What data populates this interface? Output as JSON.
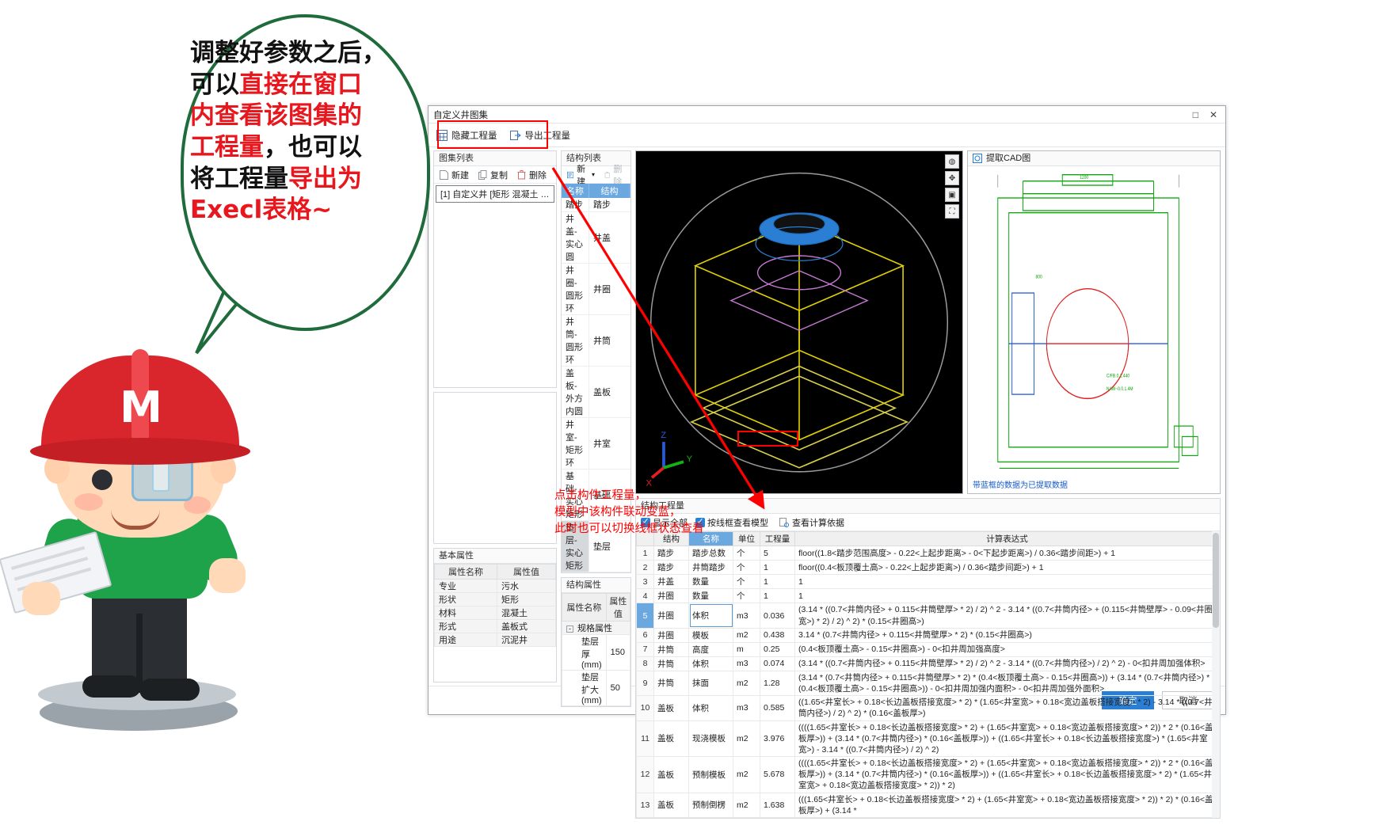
{
  "bubble": {
    "lines": [
      [
        {
          "t": "调整好参数之后，",
          "hl": false
        }
      ],
      [
        {
          "t": "可以",
          "hl": false
        },
        {
          "t": "直接在窗口",
          "hl": true
        }
      ],
      [
        {
          "t": "内查看该图集的",
          "hl": true
        }
      ],
      [
        {
          "t": "工程量",
          "hl": true
        },
        {
          "t": "，也可以",
          "hl": false
        }
      ],
      [
        {
          "t": "将工程量",
          "hl": false
        },
        {
          "t": "导出为",
          "hl": true
        }
      ],
      [
        {
          "t": "Execl表格~",
          "hl": true
        }
      ]
    ]
  },
  "annotation": {
    "note_lines": [
      "点击构件工程量，",
      "模型中该构件联动变蓝，",
      "此时也可以切换线框状态查看"
    ],
    "color": "#ff0000"
  },
  "window": {
    "title": "自定义井图集",
    "maximize_label": "□",
    "close_label": "✕"
  },
  "toolbar": {
    "items": [
      {
        "icon": "grid-hide-icon",
        "label": "隐藏工程量"
      },
      {
        "icon": "export-icon",
        "label": "导出工程量"
      }
    ]
  },
  "atlas_panel": {
    "header": "图集列表",
    "tools": [
      {
        "icon": "new-file-icon",
        "label": "新建"
      },
      {
        "icon": "copy-icon",
        "label": "复制"
      },
      {
        "icon": "trash-icon",
        "label": "删除"
      }
    ],
    "items": [
      "[1] 自定义井 [矩形 混凝土 污水 盖板..."
    ]
  },
  "basic_props": {
    "header": "基本属性",
    "columns": [
      "属性名称",
      "属性值"
    ],
    "rows": [
      [
        "专业",
        "污水"
      ],
      [
        "形状",
        "矩形"
      ],
      [
        "材料",
        "混凝土"
      ],
      [
        "形式",
        "盖板式"
      ],
      [
        "用途",
        "沉泥井"
      ]
    ]
  },
  "struct_list": {
    "header": "结构列表",
    "tools": [
      {
        "icon": "new-struct-icon",
        "label": "新建",
        "dim": false,
        "caret": "▾"
      },
      {
        "icon": "trash-icon",
        "label": "删除",
        "dim": true
      }
    ],
    "columns": [
      "名称",
      "结构"
    ],
    "rows": [
      {
        "name": "踏步",
        "struct": "踏步",
        "selected": false
      },
      {
        "name": "井盖-实心圆",
        "struct": "井盖",
        "selected": false
      },
      {
        "name": "井圈-圆形环",
        "struct": "井圈",
        "selected": false
      },
      {
        "name": "井筒-圆形环",
        "struct": "井筒",
        "selected": false
      },
      {
        "name": "盖板-外方内圆",
        "struct": "盖板",
        "selected": false
      },
      {
        "name": "井室-矩形环",
        "struct": "井室",
        "selected": false
      },
      {
        "name": "基础-实心矩形",
        "struct": "基础",
        "selected": false
      },
      {
        "name": "垫层-实心矩形",
        "struct": "垫层",
        "selected": true
      }
    ]
  },
  "struct_props": {
    "header": "结构属性",
    "columns": [
      "属性名称",
      "属性值"
    ],
    "group": "规格属性",
    "rows": [
      [
        "垫层厚(mm)",
        "150"
      ],
      [
        "垫层扩大(mm)",
        "50"
      ]
    ]
  },
  "model_view": {
    "axis_labels": [
      "X",
      "Y",
      "Z"
    ],
    "tools": [
      "orbit-icon",
      "pan-icon",
      "box-icon",
      "fit-icon"
    ]
  },
  "cad_panel": {
    "header": "提取CAD图",
    "icon": "cad-icon",
    "footer_note": "带蓝框的数据为已提取数据"
  },
  "quantity": {
    "header": "结构工程量",
    "options": [
      {
        "label": "显示全部",
        "checked": true
      },
      {
        "label": "按线框查看模型",
        "checked": true
      }
    ],
    "link": {
      "icon": "calc-basis-icon",
      "label": "查看计算依据"
    },
    "columns": [
      "",
      "结构",
      "名称",
      "单位",
      "工程量",
      "计算表达式"
    ],
    "selected_column": "名称",
    "rows": [
      {
        "idx": "1",
        "struct": "踏步",
        "name": "踏步总数",
        "unit": "个",
        "qty": "5",
        "expr": "floor((1.8<踏步范围高度> - 0.22<上起步距离> - 0<下起步距离>) / 0.36<踏步间距>) + 1",
        "selected": false,
        "boxed": false
      },
      {
        "idx": "2",
        "struct": "踏步",
        "name": "井筒踏步",
        "unit": "个",
        "qty": "1",
        "expr": "floor((0.4<板顶覆土高> - 0.22<上起步距离>) / 0.36<踏步间距>) + 1",
        "selected": false,
        "boxed": false
      },
      {
        "idx": "3",
        "struct": "井盖",
        "name": "数量",
        "unit": "个",
        "qty": "1",
        "expr": "1",
        "selected": false,
        "boxed": false
      },
      {
        "idx": "4",
        "struct": "井圈",
        "name": "数量",
        "unit": "个",
        "qty": "1",
        "expr": "1",
        "selected": false,
        "boxed": false
      },
      {
        "idx": "5",
        "struct": "井圈",
        "name": "体积",
        "unit": "m3",
        "qty": "0.036",
        "expr": "(3.14 * ((0.7<井筒内径> + 0.115<井筒壁厚> * 2) / 2) ^ 2 - 3.14 * ((0.7<井筒内径> + (0.115<井筒壁厚> - 0.09<井圈宽>) * 2) / 2) ^ 2) * (0.15<井圈高>)",
        "selected": true,
        "boxed": true
      },
      {
        "idx": "6",
        "struct": "井圈",
        "name": "模板",
        "unit": "m2",
        "qty": "0.438",
        "expr": "3.14 * (0.7<井筒内径> + 0.115<井筒壁厚> * 2) * (0.15<井圈高>)",
        "selected": false,
        "boxed": false
      },
      {
        "idx": "7",
        "struct": "井筒",
        "name": "高度",
        "unit": "m",
        "qty": "0.25",
        "expr": "(0.4<板顶覆土高> - 0.15<井圈高>) - 0<扣井周加强高度>",
        "selected": false,
        "boxed": false
      },
      {
        "idx": "8",
        "struct": "井筒",
        "name": "体积",
        "unit": "m3",
        "qty": "0.074",
        "expr": "(3.14 * ((0.7<井筒内径> + 0.115<井筒壁厚> * 2) / 2) ^ 2 - 3.14 * ((0.7<井筒内径>) / 2) ^ 2) - 0<扣井周加强体积>",
        "selected": false,
        "boxed": false
      },
      {
        "idx": "9",
        "struct": "井筒",
        "name": "抹面",
        "unit": "m2",
        "qty": "1.28",
        "expr": "(3.14 * (0.7<井筒内径> + 0.115<井筒壁厚> * 2) * (0.4<板顶覆土高> - 0.15<井圈高>)) + (3.14 * (0.7<井筒内径>) * (0.4<板顶覆土高> - 0.15<井圈高>)) - 0<扣井周加强内面积> - 0<扣井周加强外面积>",
        "selected": false,
        "boxed": false
      },
      {
        "idx": "10",
        "struct": "盖板",
        "name": "体积",
        "unit": "m3",
        "qty": "0.585",
        "expr": "((1.65<井室长> + 0.18<长边盖板搭接宽度> * 2) * (1.65<井室宽> + 0.18<宽边盖板搭接宽度> * 2) - 3.14 * ((0.7<井筒内径>) / 2) ^ 2) * (0.16<盖板厚>)",
        "selected": false,
        "boxed": false
      },
      {
        "idx": "11",
        "struct": "盖板",
        "name": "现浇模板",
        "unit": "m2",
        "qty": "3.976",
        "expr": "((((1.65<井室长> + 0.18<长边盖板搭接宽度> * 2) + (1.65<井室宽> + 0.18<宽边盖板搭接宽度> * 2)) * 2 * (0.16<盖板厚>)) + (3.14 * (0.7<井筒内径>) * (0.16<盖板厚>)) + ((1.65<井室长> + 0.18<长边盖板搭接宽度>) * (1.65<井室宽>) - 3.14 * ((0.7<井筒内径>) / 2) ^ 2)",
        "selected": false,
        "boxed": false
      },
      {
        "idx": "12",
        "struct": "盖板",
        "name": "预制模板",
        "unit": "m2",
        "qty": "5.678",
        "expr": "((((1.65<井室长> + 0.18<长边盖板搭接宽度> * 2) + (1.65<井室宽> + 0.18<宽边盖板搭接宽度> * 2)) * 2 * (0.16<盖板厚>)) + (3.14 * (0.7<井筒内径>) * (0.16<盖板厚>)) + ((1.65<井室长> + 0.18<长边盖板搭接宽度> * 2) * (1.65<井室宽> + 0.18<宽边盖板搭接宽度> * 2)) * 2)",
        "selected": false,
        "boxed": false
      },
      {
        "idx": "13",
        "struct": "盖板",
        "name": "预制倒楞",
        "unit": "m2",
        "qty": "1.638",
        "expr": "(((1.65<井室长> + 0.18<长边盖板搭接宽度> * 2) + (1.65<井室宽> + 0.18<宽边盖板搭接宽度> * 2)) * 2) * (0.16<盖板厚>) + (3.14 *",
        "selected": false,
        "boxed": false
      }
    ]
  },
  "footer": {
    "ok": "确定",
    "cancel": "取消"
  }
}
